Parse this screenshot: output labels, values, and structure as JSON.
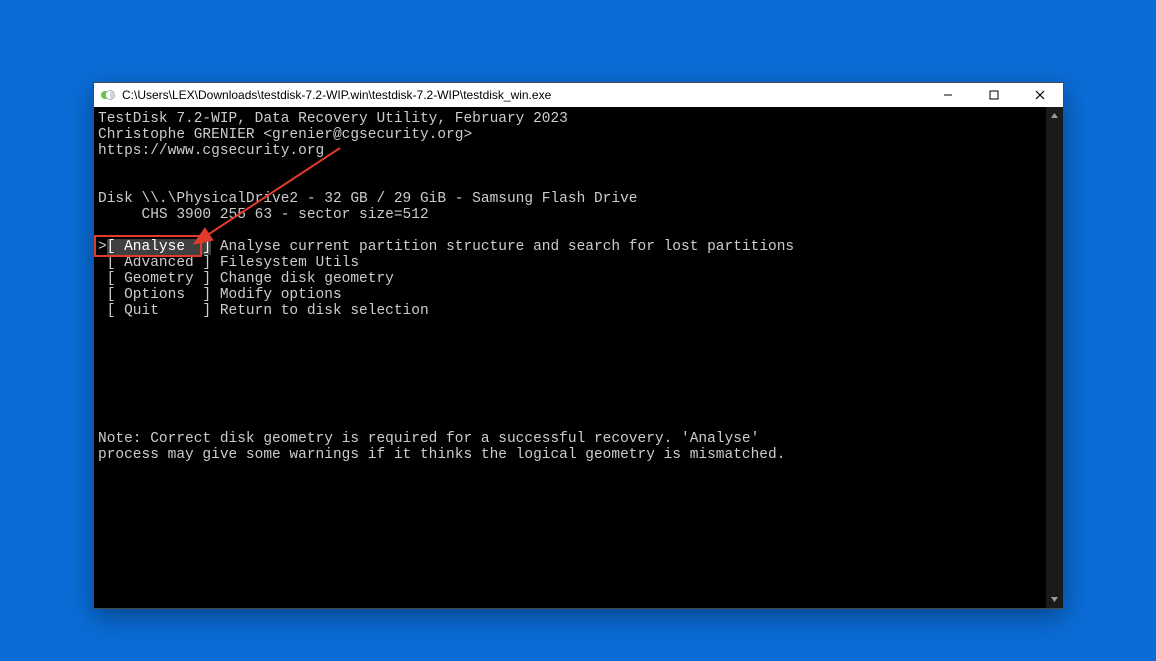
{
  "window": {
    "title": "C:\\Users\\LEX\\Downloads\\testdisk-7.2-WIP.win\\testdisk-7.2-WIP\\testdisk_win.exe",
    "controls": {
      "minimize": "—",
      "maximize": "☐",
      "close": "✕"
    }
  },
  "terminal": {
    "header": [
      "TestDisk 7.2-WIP, Data Recovery Utility, February 2023",
      "Christophe GRENIER <grenier@cgsecurity.org>",
      "https://www.cgsecurity.org"
    ],
    "disk_line": "Disk \\\\.\\PhysicalDrive2 - 32 GB / 29 GiB - Samsung Flash Drive",
    "chs_line": "     CHS 3900 255 63 - sector size=512",
    "menu": [
      {
        "cursor": ">",
        "left": "[ Analyse  ]",
        "desc": " Analyse current partition structure and search for lost partitions",
        "selected": true
      },
      {
        "cursor": " ",
        "left": "[ Advanced ]",
        "desc": " Filesystem Utils",
        "selected": false
      },
      {
        "cursor": " ",
        "left": "[ Geometry ]",
        "desc": " Change disk geometry",
        "selected": false
      },
      {
        "cursor": " ",
        "left": "[ Options  ]",
        "desc": " Modify options",
        "selected": false
      },
      {
        "cursor": " ",
        "left": "[ Quit     ]",
        "desc": " Return to disk selection",
        "selected": false
      }
    ],
    "note": [
      "Note: Correct disk geometry is required for a successful recovery. 'Analyse'",
      "process may give some warnings if it thinks the logical geometry is mismatched."
    ]
  }
}
